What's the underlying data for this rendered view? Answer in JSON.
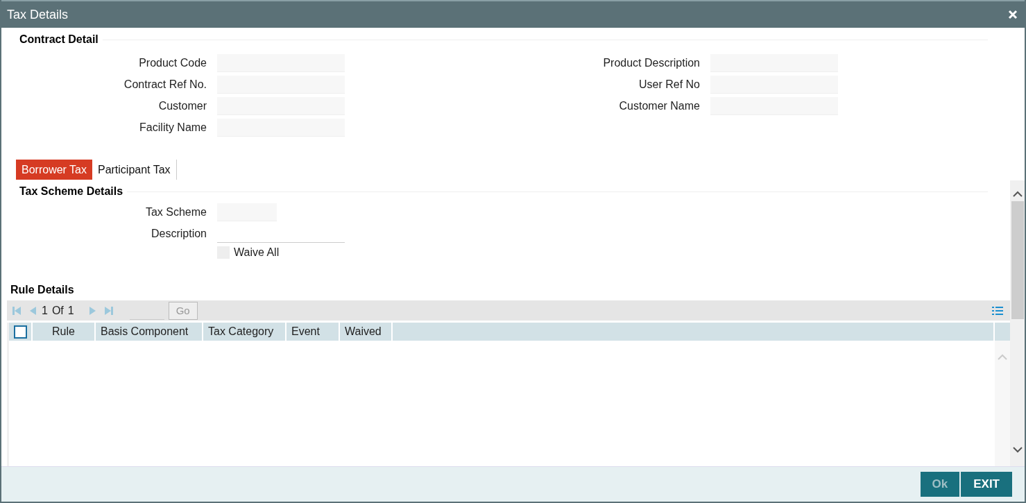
{
  "window": {
    "title": "Tax Details"
  },
  "contract_detail": {
    "title": "Contract Detail",
    "fields": [
      {
        "label": "Product Code"
      },
      {
        "label": "Product Description"
      },
      {
        "label": "Contract Ref No."
      },
      {
        "label": "User Ref No"
      },
      {
        "label": "Customer"
      },
      {
        "label": "Customer Name"
      },
      {
        "label": "Facility Name"
      }
    ]
  },
  "tabs": [
    {
      "label": "Borrower Tax",
      "selected": true
    },
    {
      "label": "Participant Tax",
      "selected": false
    }
  ],
  "tax_scheme_details": {
    "title": "Tax Scheme Details",
    "tax_scheme_label": "Tax Scheme",
    "description_label": "Description",
    "waive_all": {
      "label": "Waive All",
      "checked": false
    }
  },
  "rule_details": {
    "title": "Rule Details",
    "pager": {
      "current": "1",
      "of": "Of",
      "total": "1",
      "go": "Go"
    },
    "select_all_checked": false,
    "columns": [
      "Rule",
      "Basis Component",
      "Tax Category",
      "Event",
      "Waived"
    ]
  },
  "footer": {
    "buttons": [
      {
        "label": "Ok",
        "disabled": true
      },
      {
        "label": "EXIT",
        "disabled": false
      }
    ]
  }
}
